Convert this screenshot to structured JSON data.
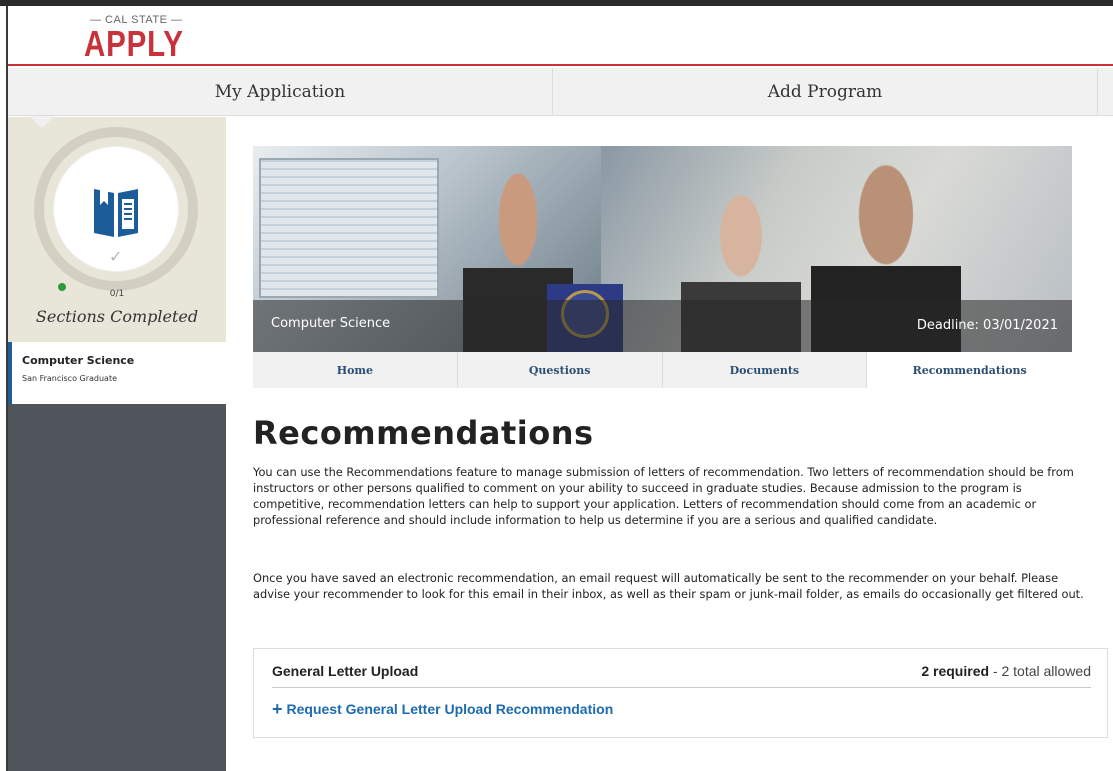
{
  "brand": {
    "top": "— CAL STATE —",
    "main": "APPLY",
    "accent_color": "#c8323a"
  },
  "nav": {
    "items": [
      {
        "label": "My Application"
      },
      {
        "label": "Add Program"
      }
    ]
  },
  "sidebar": {
    "progress_count": "0/1",
    "sections_label": "Sections Completed",
    "program_name": "Computer Science",
    "campus": "San Francisco Graduate"
  },
  "banner": {
    "program_title": "Computer Science",
    "deadline": "Deadline: 03/01/2021"
  },
  "tabs": [
    {
      "label": "Home"
    },
    {
      "label": "Questions"
    },
    {
      "label": "Documents"
    },
    {
      "label": "Recommendations",
      "active": true
    }
  ],
  "page": {
    "title": "Recommendations",
    "paragraph1": "You can use the Recommendations feature to manage submission of letters of recommendation.  Two letters of recommendation should be from instructors or other persons qualified to comment on your ability to succeed in graduate studies. Because admission to the program is competitive, recommendation letters can help to support your application.  Letters of recommendation should come from an academic or professional reference and should include information to help us determine if you are a serious and qualified candidate.",
    "paragraph2": "Once you have saved an electronic recommendation, an email request will automatically be sent to the recommender on your behalf. Please advise your recommender to look for this email in their inbox, as well as their spam or junk-mail folder, as emails do occasionally get filtered out."
  },
  "recommendation": {
    "heading": "General Letter Upload",
    "required": "2 required",
    "allowed": " - 2 total allowed",
    "request_link": "Request General Letter Upload Recommendation",
    "link_color": "#1c6bb0"
  }
}
